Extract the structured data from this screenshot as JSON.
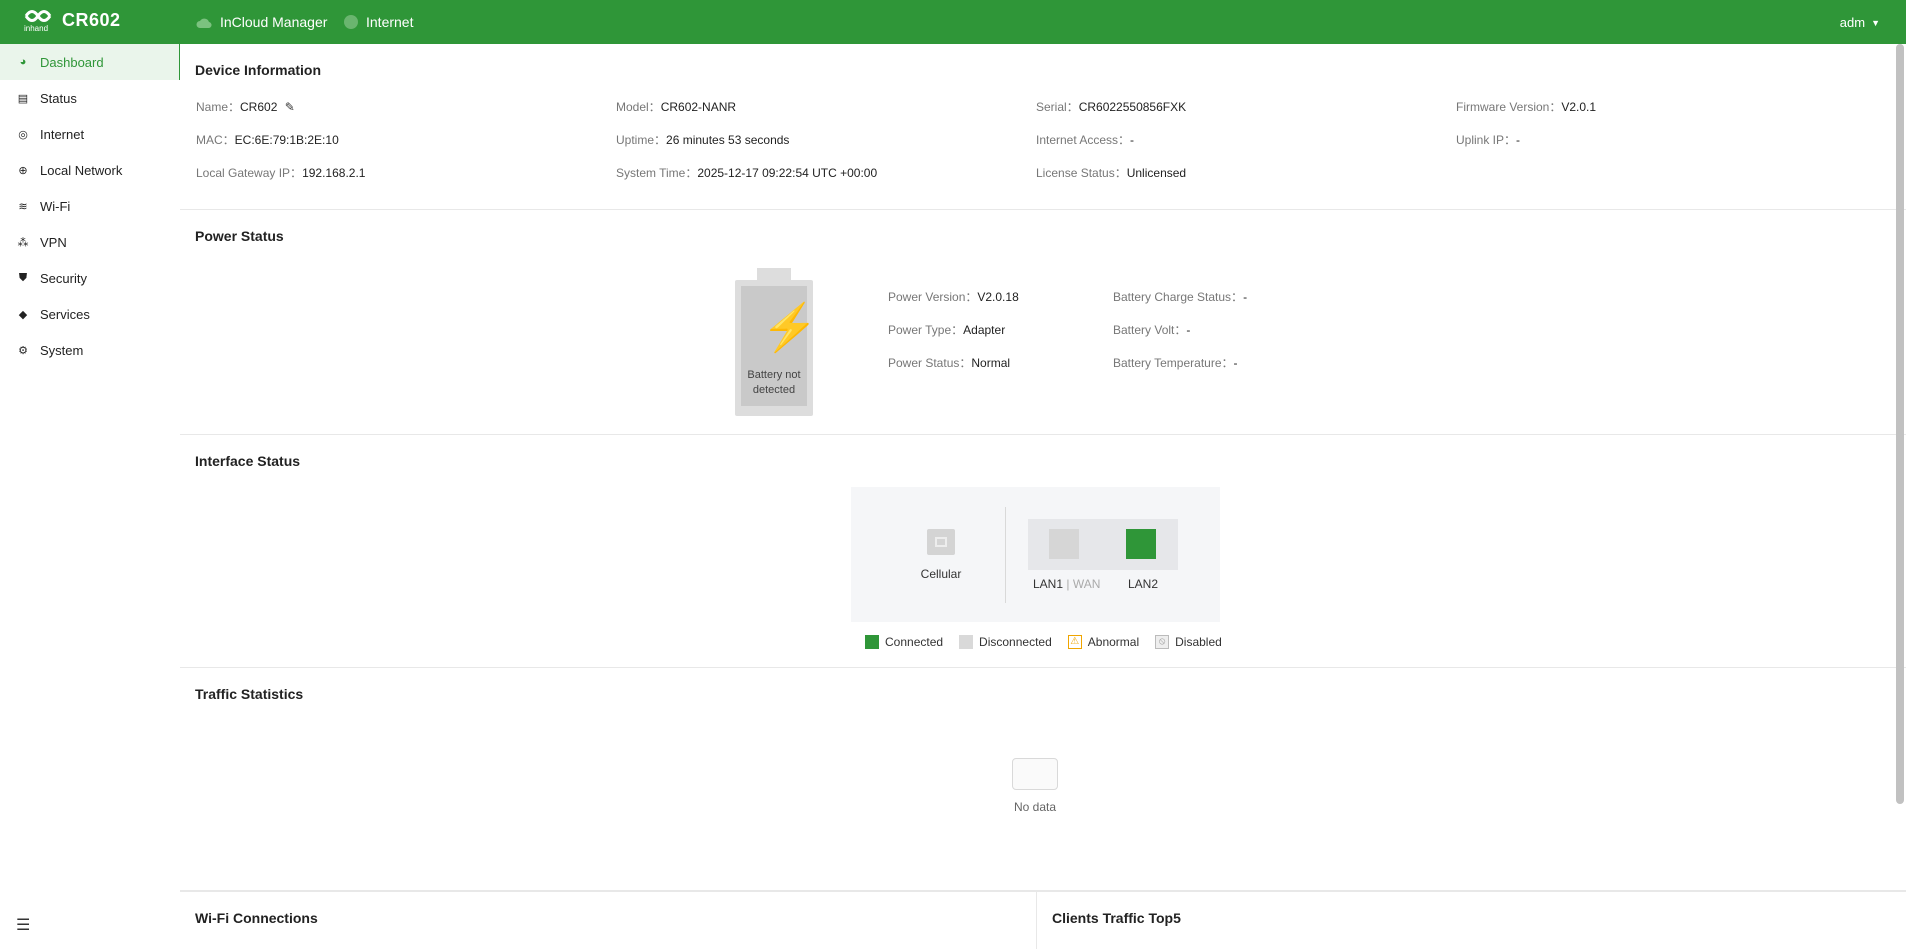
{
  "header": {
    "product": "CR602",
    "logo_text": "inhand",
    "links": [
      "InCloud Manager",
      "Internet"
    ],
    "user": "adm"
  },
  "sidebar": {
    "items": [
      {
        "label": "Dashboard",
        "icon": "dashboard-icon"
      },
      {
        "label": "Status",
        "icon": "status-icon"
      },
      {
        "label": "Internet",
        "icon": "internet-icon"
      },
      {
        "label": "Local Network",
        "icon": "globe-icon"
      },
      {
        "label": "Wi-Fi",
        "icon": "wifi-icon"
      },
      {
        "label": "VPN",
        "icon": "vpn-icon"
      },
      {
        "label": "Security",
        "icon": "shield-icon"
      },
      {
        "label": "Services",
        "icon": "cube-icon"
      },
      {
        "label": "System",
        "icon": "gear-icon"
      }
    ]
  },
  "device": {
    "title": "Device Information",
    "name_label": "Name：",
    "name": "CR602",
    "model_label": "Model：",
    "model": "CR602-NANR",
    "serial_label": "Serial：",
    "serial": "CR6022550856FXK",
    "firmware_label": "Firmware Version：",
    "firmware": "V2.0.1",
    "mac_label": "MAC：",
    "mac": "EC:6E:79:1B:2E:10",
    "uptime_label": "Uptime：",
    "uptime": "26 minutes 53 seconds",
    "internet_access_label": "Internet Access：",
    "internet_access": "-",
    "uplink_ip_label": "Uplink IP：",
    "uplink_ip": "-",
    "gateway_label": "Local Gateway IP：",
    "gateway": "192.168.2.1",
    "system_time_label": "System Time：",
    "system_time": "2025-12-17 09:22:54 UTC +00:00",
    "license_label": "License Status：",
    "license": "Unlicensed"
  },
  "power": {
    "title": "Power Status",
    "battery_text": "Battery not detected",
    "version_label": "Power Version：",
    "version": "V2.0.18",
    "type_label": "Power Type：",
    "type": "Adapter",
    "status_label": "Power Status：",
    "status": "Normal",
    "charge_label": "Battery Charge Status：",
    "charge": "-",
    "volt_label": "Battery Volt：",
    "volt": "-",
    "temp_label": "Battery Temperature：",
    "temp": "-"
  },
  "interface": {
    "title": "Interface Status",
    "cellular": "Cellular",
    "lan1": "LAN1",
    "wan": "WAN",
    "lan2": "LAN2",
    "legend": [
      "Connected",
      "Disconnected",
      "Abnormal",
      "Disabled"
    ],
    "colors": {
      "connected": "#2f9638",
      "disconnected": "#d9d9d9",
      "abnormal": "#f0a500"
    }
  },
  "traffic": {
    "title": "Traffic Statistics",
    "empty": "No data"
  },
  "wifi_connections": {
    "title": "Wi-Fi Connections"
  },
  "clients_top": {
    "title": "Clients Traffic Top5"
  }
}
